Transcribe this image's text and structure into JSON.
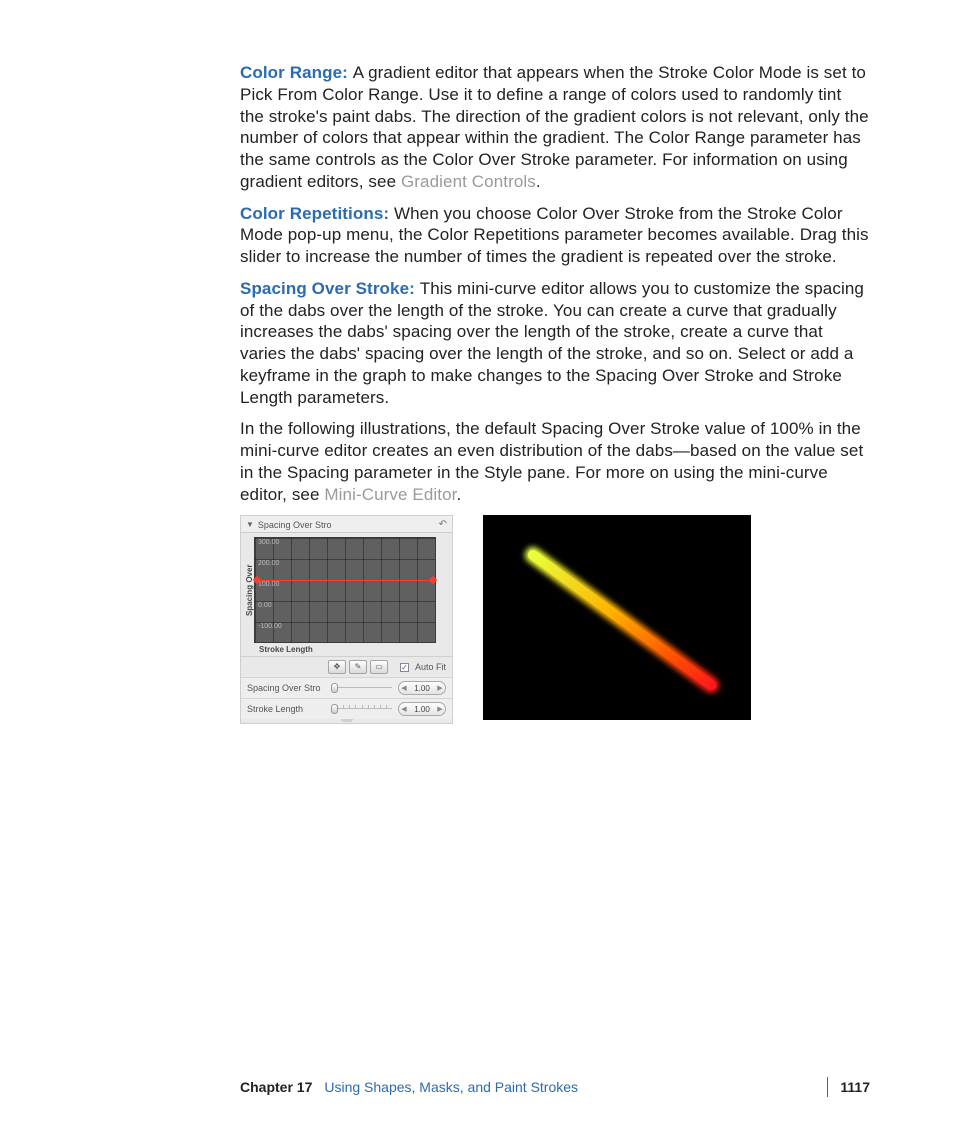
{
  "paragraphs": {
    "p1": {
      "term": "Color Range:  ",
      "body": "A gradient editor that appears when the Stroke Color Mode is set to Pick From Color Range. Use it to define a range of colors used to randomly tint the stroke's paint dabs. The direction of the gradient colors is not relevant, only the number of colors that appear within the gradient. The Color Range parameter has the same controls as the Color Over Stroke parameter. For information on using gradient editors, see ",
      "link": "Gradient Controls",
      "tail": "."
    },
    "p2": {
      "term": "Color Repetitions:  ",
      "body": "When you choose Color Over Stroke from the Stroke Color Mode pop-up menu, the Color Repetitions parameter becomes available. Drag this slider to increase the number of times the gradient is repeated over the stroke."
    },
    "p3": {
      "term": "Spacing Over Stroke:  ",
      "body": "This mini-curve editor allows you to customize the spacing of the dabs over the length of the stroke. You can create a curve that gradually increases the dabs' spacing over the length of the stroke, create a curve that varies the dabs' spacing over the length of the stroke, and so on. Select or add a keyframe in the graph to make changes to the Spacing Over Stroke and Stroke Length parameters."
    },
    "p4": {
      "body1": "In the following illustrations, the default Spacing Over Stroke value of 100% in the mini-curve editor creates an even distribution of the dabs—based on the value set in the Spacing parameter in the Style pane. For more on using the mini-curve editor, see ",
      "link": "Mini-Curve Editor",
      "tail": "."
    }
  },
  "panel": {
    "header": "Spacing Over Stro",
    "yticks": [
      "300.00",
      "200.00",
      "100.00",
      "0.00",
      "-100.00"
    ],
    "ylabel": "Spacing Over",
    "xlabel": "Stroke Length",
    "autofit": "Auto Fit",
    "rows": [
      {
        "label": "Spacing Over Stro",
        "value": "1.00"
      },
      {
        "label": "Stroke Length",
        "value": "1.00"
      }
    ]
  },
  "chart_data": {
    "type": "line",
    "title": "Spacing Over Stroke",
    "xlabel": "Stroke Length",
    "ylabel": "Spacing Over",
    "ylim": [
      -100,
      300
    ],
    "x": [
      0.0,
      1.0
    ],
    "values": [
      100,
      100
    ]
  },
  "footer": {
    "chapter": "Chapter 17",
    "title": "Using Shapes, Masks, and Paint Strokes",
    "page": "1117"
  }
}
